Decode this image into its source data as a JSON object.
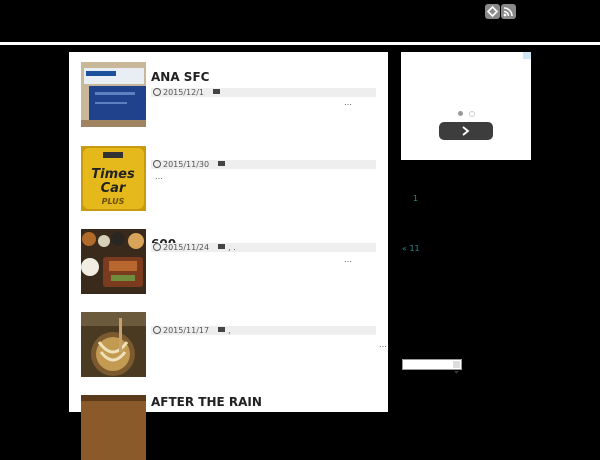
{
  "header": {
    "icons": [
      "feedly-icon",
      "rss-icon"
    ]
  },
  "posts": [
    {
      "title": "ANA SFC",
      "date": "2015/12/1",
      "tags": "",
      "more": "…"
    },
    {
      "title": "",
      "date": "2015/11/30",
      "tags": "",
      "more": "…"
    },
    {
      "title": "600",
      "date": "2015/11/24",
      "tags": ", .",
      "more": "…"
    },
    {
      "title": "",
      "date": "2015/11/17",
      "tags": ",",
      "more": "…"
    },
    {
      "title": "AFTER THE RAIN",
      "date": "",
      "tags": "",
      "more": ""
    }
  ],
  "sidebar": {
    "page_number": "1",
    "prev_link": "« 11",
    "ad_dots": 2
  },
  "colors": {
    "background": "#000000",
    "content": "#ffffff",
    "link": "#2a8a8a"
  }
}
